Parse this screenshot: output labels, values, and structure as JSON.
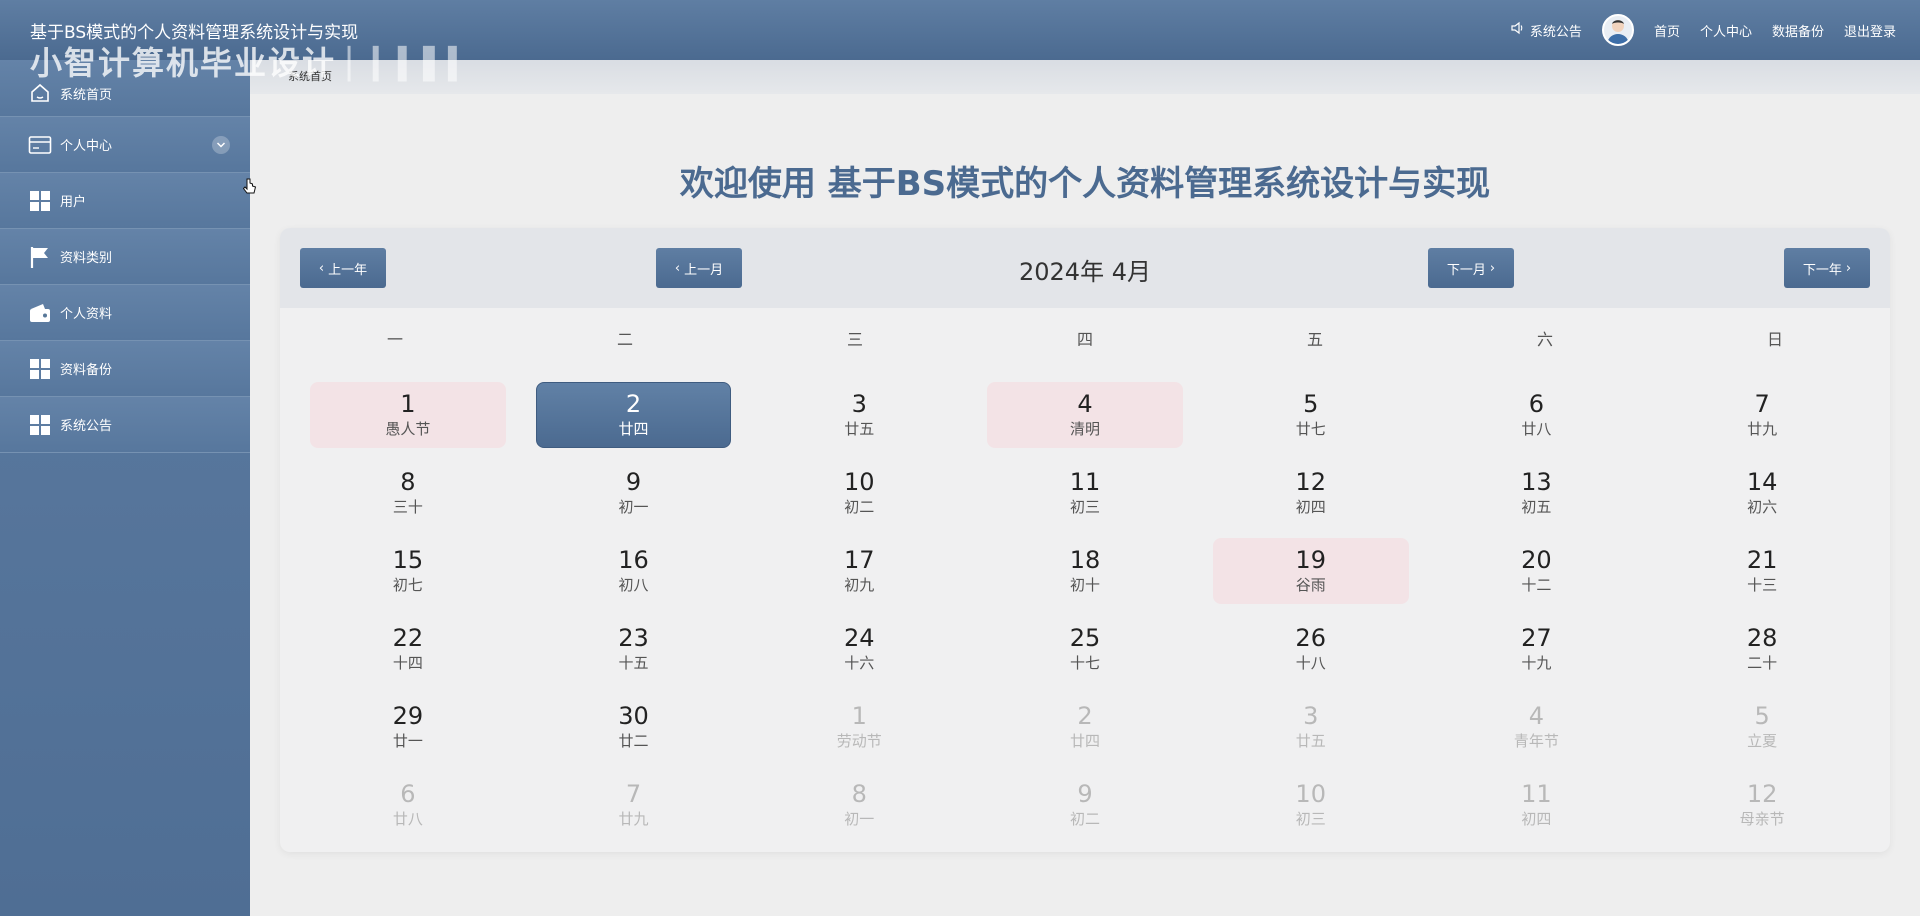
{
  "header": {
    "system_title": "基于BS模式的个人资料管理系统设计与实现",
    "notice_label": "系统公告",
    "links": [
      "首页",
      "个人中心",
      "数据备份",
      "退出登录"
    ]
  },
  "watermark": "小智计算机毕业设计",
  "sidebar": {
    "items": [
      {
        "label": "系统首页",
        "icon": "home-icon"
      },
      {
        "label": "个人中心",
        "icon": "card-icon"
      },
      {
        "label": "用户",
        "icon": "grid-icon"
      },
      {
        "label": "资料类别",
        "icon": "flag-icon"
      },
      {
        "label": "个人资料",
        "icon": "wallet-icon"
      },
      {
        "label": "资料备份",
        "icon": "grid-icon"
      },
      {
        "label": "系统公告",
        "icon": "grid-icon"
      }
    ]
  },
  "breadcrumb": "系统首页",
  "welcome": "欢迎使用 基于BS模式的个人资料管理系统设计与实现",
  "calendar": {
    "title": "2024年 4月",
    "prev_year": "上一年",
    "prev_month": "上一月",
    "next_month": "下一月",
    "next_year": "下一年",
    "weekdays": [
      "一",
      "二",
      "三",
      "四",
      "五",
      "六",
      "日"
    ],
    "days": [
      {
        "d": "1",
        "s": "愚人节",
        "t": "holiday"
      },
      {
        "d": "2",
        "s": "廿四",
        "t": "today"
      },
      {
        "d": "3",
        "s": "廿五",
        "t": ""
      },
      {
        "d": "4",
        "s": "清明",
        "t": "holiday"
      },
      {
        "d": "5",
        "s": "廿七",
        "t": ""
      },
      {
        "d": "6",
        "s": "廿八",
        "t": ""
      },
      {
        "d": "7",
        "s": "廿九",
        "t": ""
      },
      {
        "d": "8",
        "s": "三十",
        "t": ""
      },
      {
        "d": "9",
        "s": "初一",
        "t": ""
      },
      {
        "d": "10",
        "s": "初二",
        "t": ""
      },
      {
        "d": "11",
        "s": "初三",
        "t": ""
      },
      {
        "d": "12",
        "s": "初四",
        "t": ""
      },
      {
        "d": "13",
        "s": "初五",
        "t": ""
      },
      {
        "d": "14",
        "s": "初六",
        "t": ""
      },
      {
        "d": "15",
        "s": "初七",
        "t": ""
      },
      {
        "d": "16",
        "s": "初八",
        "t": ""
      },
      {
        "d": "17",
        "s": "初九",
        "t": ""
      },
      {
        "d": "18",
        "s": "初十",
        "t": ""
      },
      {
        "d": "19",
        "s": "谷雨",
        "t": "holiday"
      },
      {
        "d": "20",
        "s": "十二",
        "t": ""
      },
      {
        "d": "21",
        "s": "十三",
        "t": ""
      },
      {
        "d": "22",
        "s": "十四",
        "t": ""
      },
      {
        "d": "23",
        "s": "十五",
        "t": ""
      },
      {
        "d": "24",
        "s": "十六",
        "t": ""
      },
      {
        "d": "25",
        "s": "十七",
        "t": ""
      },
      {
        "d": "26",
        "s": "十八",
        "t": ""
      },
      {
        "d": "27",
        "s": "十九",
        "t": ""
      },
      {
        "d": "28",
        "s": "二十",
        "t": ""
      },
      {
        "d": "29",
        "s": "廿一",
        "t": ""
      },
      {
        "d": "30",
        "s": "廿二",
        "t": ""
      },
      {
        "d": "1",
        "s": "劳动节",
        "t": "other"
      },
      {
        "d": "2",
        "s": "廿四",
        "t": "other"
      },
      {
        "d": "3",
        "s": "廿五",
        "t": "other"
      },
      {
        "d": "4",
        "s": "青年节",
        "t": "other"
      },
      {
        "d": "5",
        "s": "立夏",
        "t": "other"
      },
      {
        "d": "6",
        "s": "廿八",
        "t": "other"
      },
      {
        "d": "7",
        "s": "廿九",
        "t": "other"
      },
      {
        "d": "8",
        "s": "初一",
        "t": "other"
      },
      {
        "d": "9",
        "s": "初二",
        "t": "other"
      },
      {
        "d": "10",
        "s": "初三",
        "t": "other"
      },
      {
        "d": "11",
        "s": "初四",
        "t": "other"
      },
      {
        "d": "12",
        "s": "母亲节",
        "t": "other"
      }
    ]
  },
  "colors": {
    "primary": "#4b6a90",
    "holiday_bg": "#f3e3e6",
    "page_bg": "#eeeeee"
  }
}
